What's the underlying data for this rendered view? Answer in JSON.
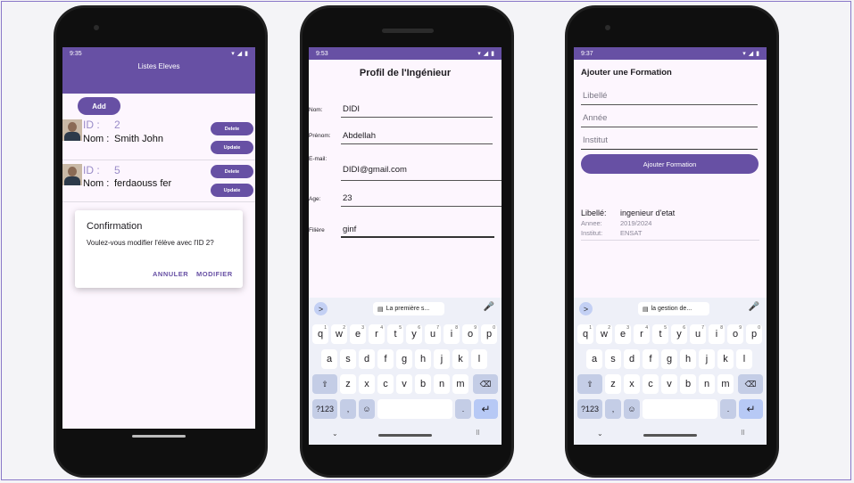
{
  "phones": {
    "p1": {
      "status_time": "9:35",
      "app_title": "Listes Eleves",
      "add_label": "Add",
      "students": [
        {
          "id_label": "ID :",
          "id": "2",
          "nom_label": "Nom :",
          "name": "Smith John",
          "delete_label": "Delete",
          "update_label": "Update"
        },
        {
          "id_label": "ID :",
          "id": "5",
          "nom_label": "Nom :",
          "name": "ferdaouss fer",
          "delete_label": "Delete",
          "update_label": "Update"
        }
      ],
      "dialog": {
        "title": "Confirmation",
        "message": "Voulez-vous modifier l'élève avec l'ID 2?",
        "cancel": "ANNULER",
        "confirm": "MODIFIER"
      }
    },
    "p2": {
      "status_time": "9:53",
      "title": "Profil de l'Ingénieur",
      "fields": [
        {
          "label": "Nom:",
          "value": "DIDI"
        },
        {
          "label": "Prénom:",
          "value": "Abdellah"
        },
        {
          "label": "E-mail:",
          "value": "DIDI@gmail.com"
        },
        {
          "label": "Age:",
          "value": "23"
        },
        {
          "label": "Filière",
          "value": "ginf"
        }
      ],
      "suggestion": "La première s..."
    },
    "p3": {
      "status_time": "9:37",
      "title": "Ajouter une Formation",
      "placeholders": {
        "libelle": "Libellé",
        "annee": "Année",
        "institut": "Institut"
      },
      "button": "Ajouter Formation",
      "result": {
        "libelle_label": "Libellé:",
        "libelle_value": "ingenieur d'etat",
        "annee_label": "Annee:",
        "annee_value": "2019/2024",
        "institut_label": "Institut:",
        "institut_value": "ENSAT"
      },
      "suggestion": "la gestion de..."
    }
  },
  "keyboard": {
    "row1": [
      "q",
      "w",
      "e",
      "r",
      "t",
      "y",
      "u",
      "i",
      "o",
      "p"
    ],
    "row1_hints": [
      "1",
      "2",
      "3",
      "4",
      "5",
      "6",
      "7",
      "8",
      "9",
      "0"
    ],
    "row2": [
      "a",
      "s",
      "d",
      "f",
      "g",
      "h",
      "j",
      "k",
      "l"
    ],
    "row3": [
      "z",
      "x",
      "c",
      "v",
      "b",
      "n",
      "m"
    ],
    "symbols": "?123",
    "comma": ",",
    "period": ".",
    "arrow": ">",
    "shift": "⇧",
    "backspace": "⌫",
    "emoji": "☺",
    "enter": "↵",
    "mic": "🎤",
    "hide": "⌄",
    "grid": "⠿"
  },
  "colors": {
    "primary": "#6750a4",
    "surface": "#fdf6fe"
  }
}
